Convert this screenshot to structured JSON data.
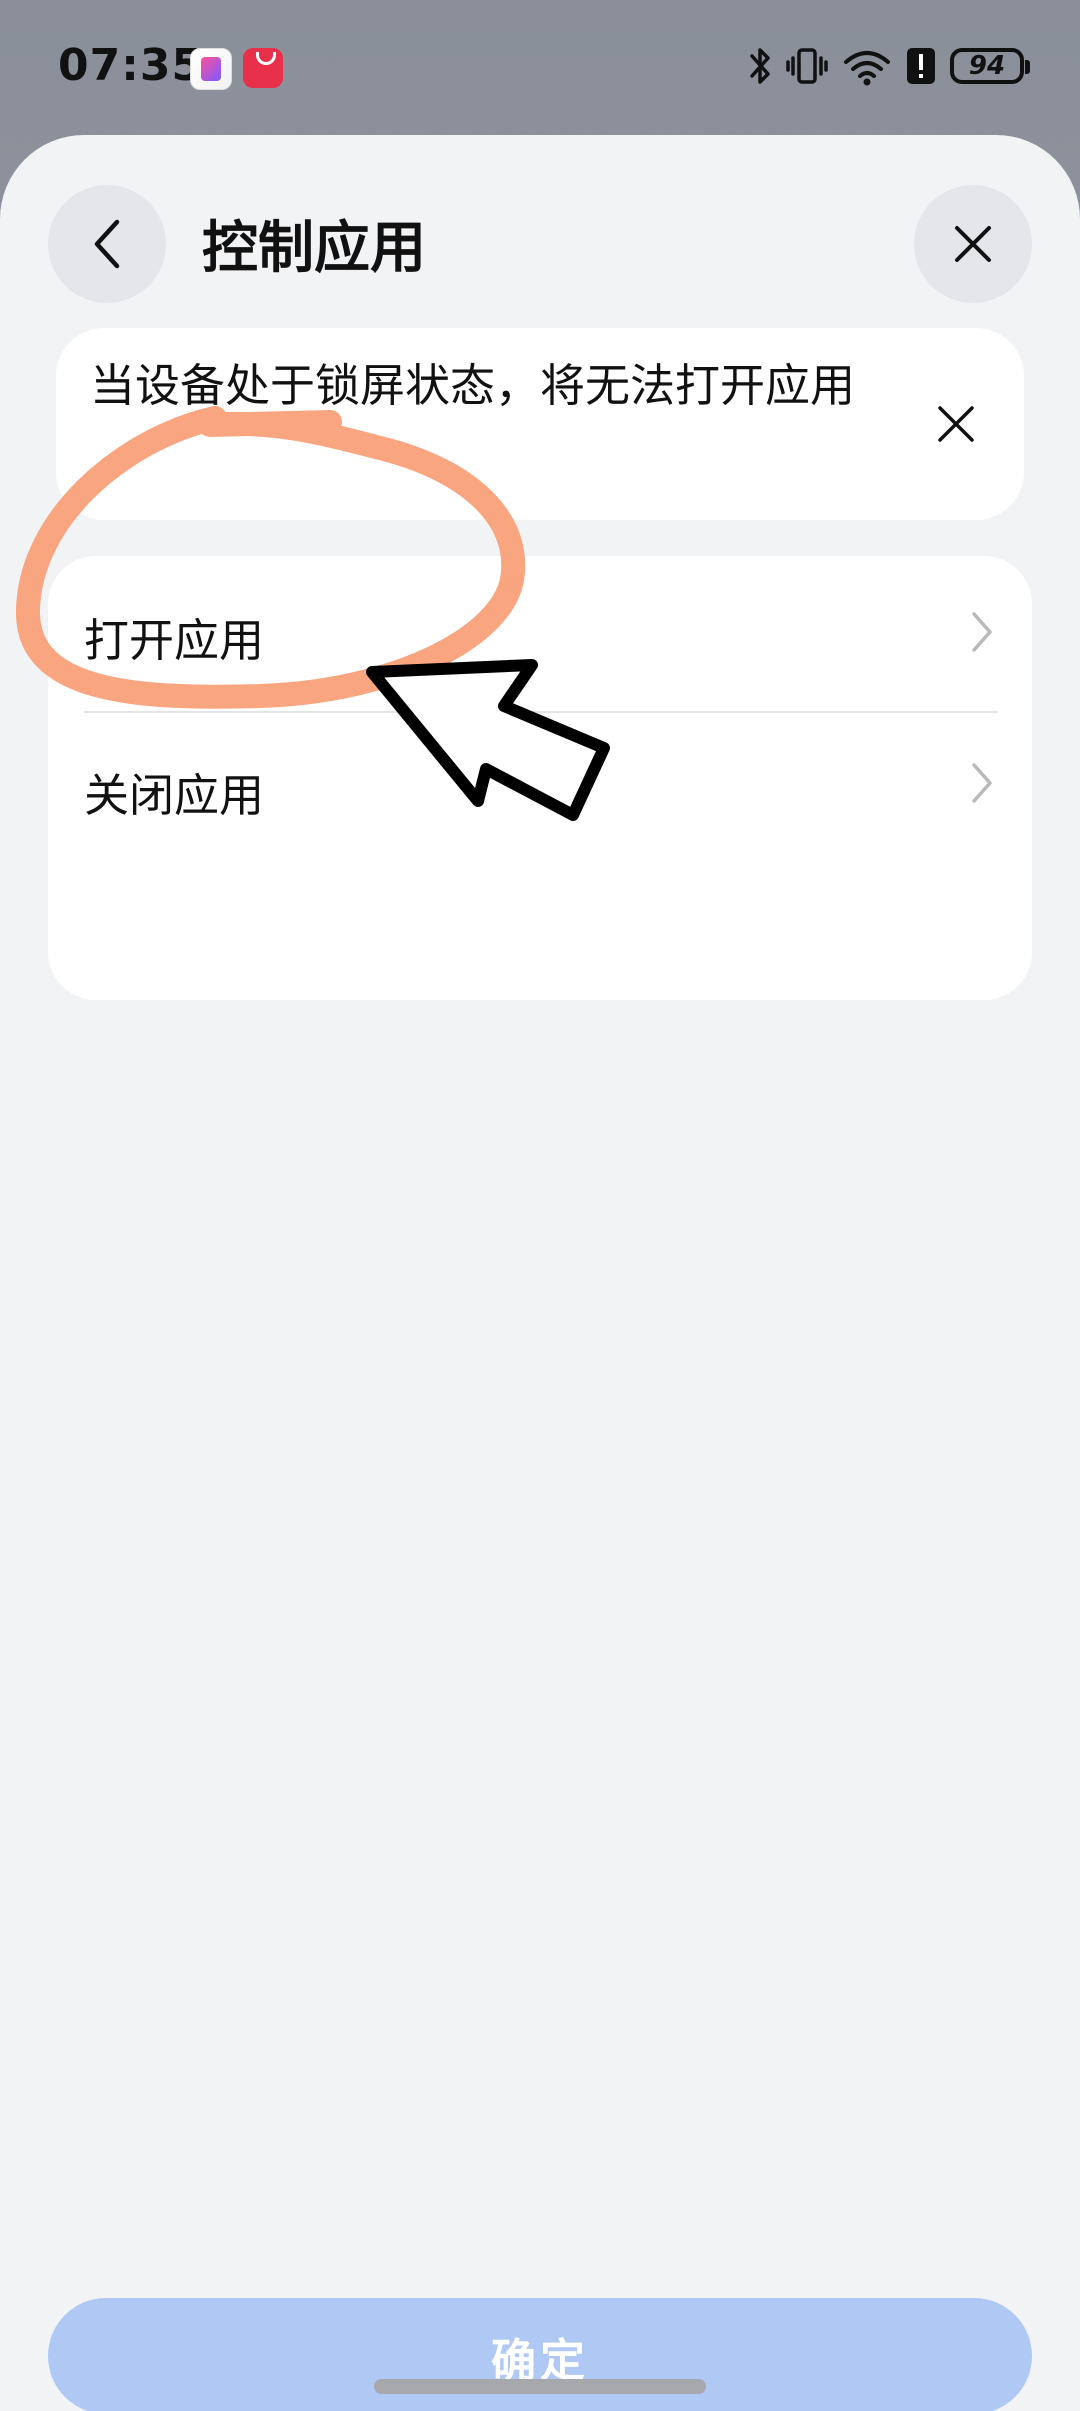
{
  "status_bar": {
    "time": "07:35",
    "battery": "94",
    "app_icons": [
      "books-icon",
      "app-gallery-icon"
    ],
    "system_icons": [
      "bluetooth-icon",
      "vibrate-icon",
      "wifi-icon",
      "alert-icon"
    ]
  },
  "header": {
    "title": "控制应用"
  },
  "notice": {
    "text": "当设备处于锁屏状态，将无法打开应用"
  },
  "options": [
    {
      "label": "打开应用"
    },
    {
      "label": "关闭应用"
    }
  ],
  "footer": {
    "confirm_label": "确定"
  },
  "colors": {
    "sheet_background": "#f1f3f5",
    "confirm_button_disabled": "#b0c8f4",
    "annotation_circle": "#f9a079",
    "annotation_arrow": "#000000"
  }
}
